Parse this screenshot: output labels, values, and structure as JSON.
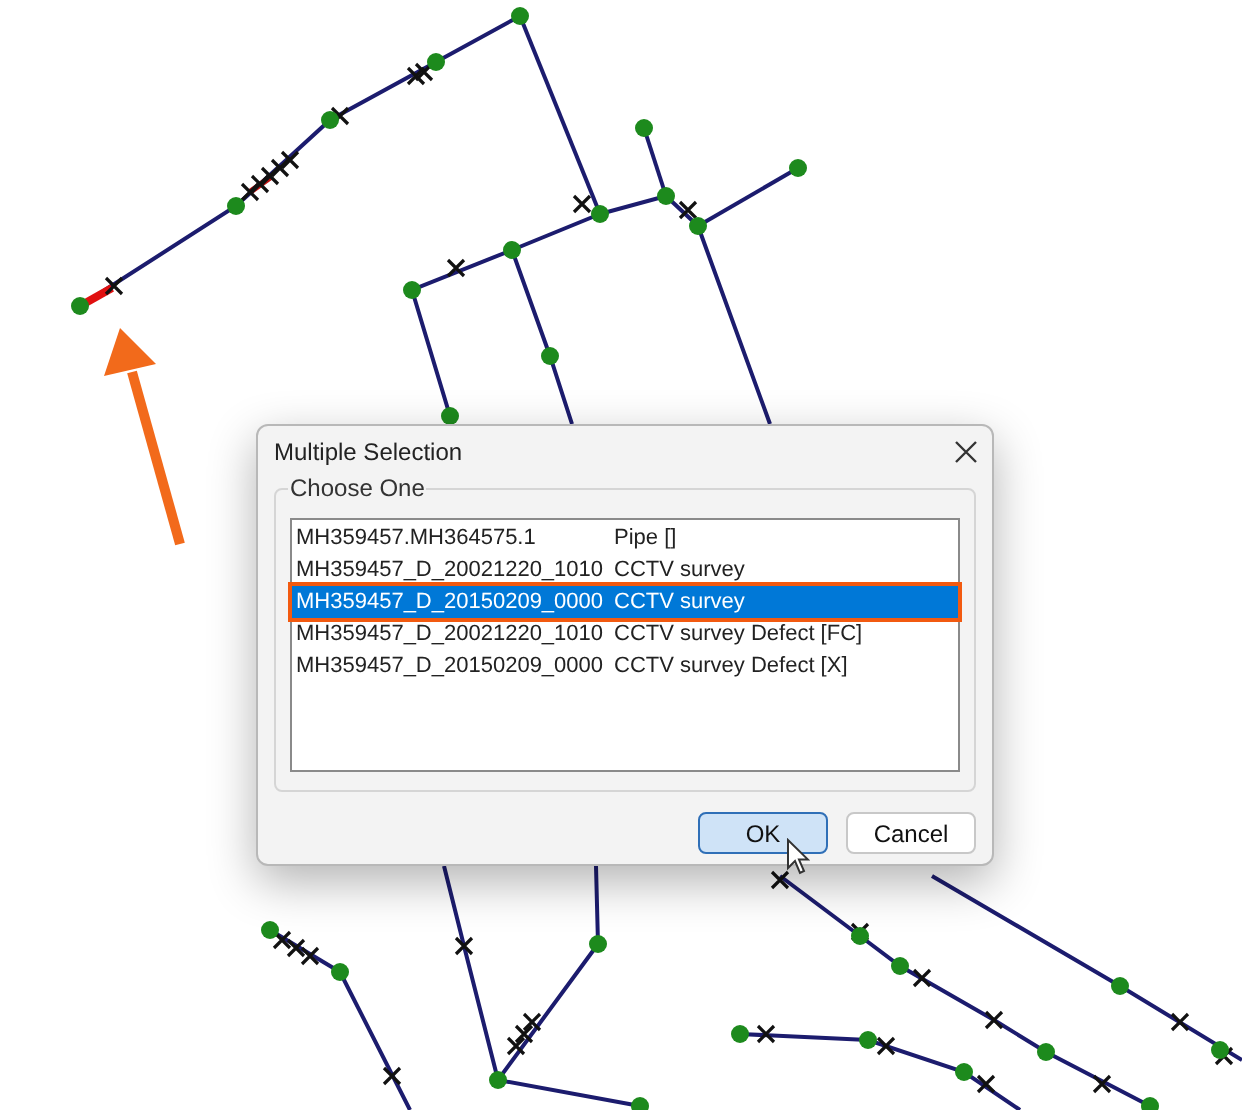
{
  "dialog": {
    "title": "Multiple Selection",
    "group_label": "Choose One",
    "rows": [
      {
        "name": "MH359457.MH364575.1",
        "type": "Pipe []",
        "selected": false
      },
      {
        "name": "MH359457_D_20021220_1010",
        "type": "CCTV survey",
        "selected": false
      },
      {
        "name": "MH359457_D_20150209_0000",
        "type": "CCTV survey",
        "selected": true
      },
      {
        "name": "MH359457_D_20021220_1010",
        "type": "CCTV survey Defect [FC]",
        "selected": false
      },
      {
        "name": "MH359457_D_20150209_0000",
        "type": "CCTV survey Defect [X]",
        "selected": false
      }
    ],
    "buttons": [
      {
        "label": "OK",
        "default": true
      },
      {
        "label": "Cancel",
        "default": false
      }
    ]
  }
}
